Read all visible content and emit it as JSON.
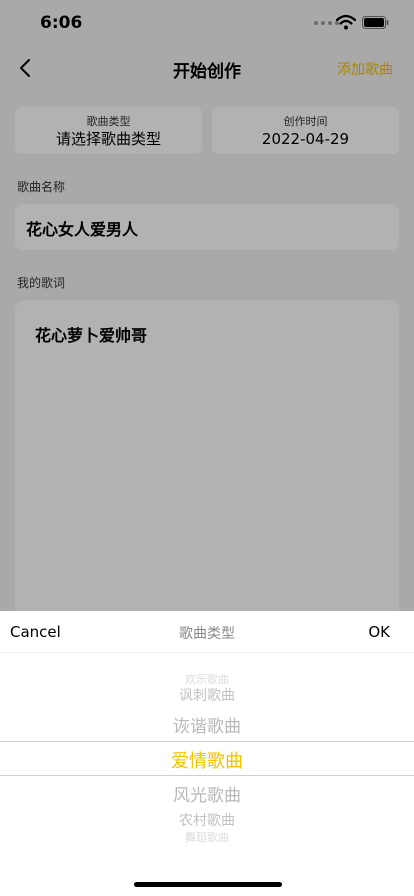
{
  "status_bar": {
    "time": "6:06"
  },
  "nav": {
    "title": "开始创作",
    "add_song": "添加歌曲"
  },
  "cards": {
    "type_label": "歌曲类型",
    "type_value": "请选择歌曲类型",
    "date_label": "创作时间",
    "date_value": "2022-04-29"
  },
  "song_name": {
    "label": "歌曲名称",
    "value": "花心女人爱男人"
  },
  "lyrics": {
    "label": "我的歌词",
    "value": "花心萝卜爱帅哥"
  },
  "picker": {
    "cancel": "Cancel",
    "title": "歌曲类型",
    "ok": "OK",
    "options": [
      {
        "label": "欢乐歌曲"
      },
      {
        "label": "讽刺歌曲"
      },
      {
        "label": "诙谐歌曲"
      },
      {
        "label": "爱情歌曲"
      },
      {
        "label": "风光歌曲"
      },
      {
        "label": "农村歌曲"
      },
      {
        "label": "舞蹈歌曲"
      }
    ],
    "selected_index": 3
  },
  "colors": {
    "accent": "#f2c200",
    "dim_overlay": "rgba(0,0,0,0.30)"
  }
}
